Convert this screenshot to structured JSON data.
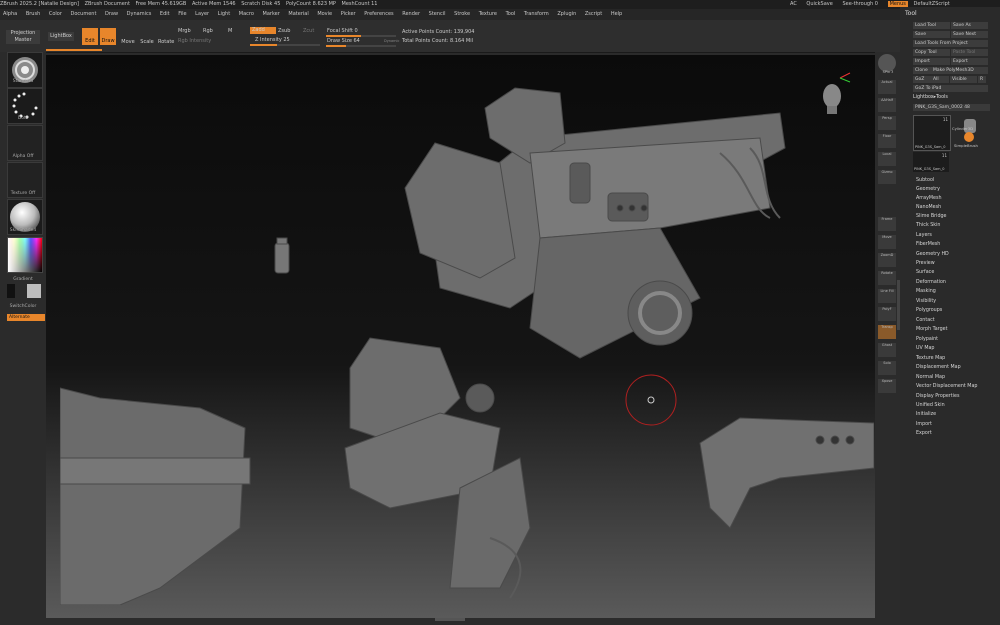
{
  "titlebar": {
    "items": [
      "ZBrush 2025.2 [Natalie Design]",
      "ZBrush Document",
      "Free Mem 45.619GB",
      "Active Mem 1546",
      "Scratch Disk 45",
      "PolyCount 8.623 MP",
      "MeshCount 11"
    ],
    "right": [
      "AC",
      "QuickSave",
      "See-through  0",
      "Menus",
      "DefaultZScript"
    ]
  },
  "menubar": [
    "Alpha",
    "Brush",
    "Color",
    "Document",
    "Draw",
    "Dynamics",
    "Edit",
    "File",
    "Layer",
    "Light",
    "Macro",
    "Marker",
    "Material",
    "Movie",
    "Picker",
    "Preferences",
    "Render",
    "Stencil",
    "Stroke",
    "Texture",
    "Tool",
    "Transform",
    "Zplugin",
    "Zscript",
    "Help"
  ],
  "toolbar": {
    "projection_master": "Projection Master",
    "lightbox": "LightBox",
    "edit": "Edit",
    "draw": "Draw",
    "move": "Move",
    "scale": "Scale",
    "rotate": "Rotate",
    "mrgb": "Mrgb",
    "rgb": "Rgb",
    "m": "M",
    "rgb_intensity": "Rgb Intensity",
    "zadd": "Zadd",
    "zsub": "Zsub",
    "zcut": "Zcut",
    "z_intensity": "Z Intensity 25",
    "focal_shift": "Focal Shift 0",
    "draw_size": "Draw Size 64",
    "dynamic": "Dynamic",
    "active_points": "Active Points Count: 139,904",
    "total_points": "Total Points Count: 8.164 Mil"
  },
  "leftshelf": {
    "standard": "Standard",
    "dots": "Dots",
    "alpha_off": "Alpha Off",
    "texture_off": "Texture Off",
    "material": "SkinShade4",
    "gradient": "Gradient",
    "switch_color": "SwitchColor",
    "alternate": "Alternate"
  },
  "rightshelf": [
    "SPix 3",
    "Actual",
    "AAHalf",
    "Persp",
    "Floor",
    "Local",
    "Gizmo",
    "Frame",
    "Move",
    "ZoomD",
    "Rotate",
    "Line Fill",
    "PolyF",
    "Transp",
    "Ghost",
    "Solo",
    "Xpose"
  ],
  "panel": {
    "title": "Tool",
    "buttons": [
      [
        "Load Tool",
        "Save As"
      ],
      [
        "Save",
        "Save Next"
      ],
      [
        "Load Tools From Project",
        ""
      ],
      [
        "Copy Tool",
        "Paste Tool"
      ],
      [
        "Import",
        "Export"
      ],
      [
        "Clone",
        "Make PolyMesh3D"
      ],
      [
        "GoZ",
        "All",
        "Visible",
        "R"
      ],
      [
        "GoZ To iPad",
        ""
      ]
    ],
    "lightbox_tools": "Lightbox▸Tools",
    "current_tool": "PINK_G3S_Sam_0002 48",
    "thumbs": [
      "PINK_G3S_Sam_0",
      "Cylinder3D",
      "SimpleBrush",
      "PINK_G3S_Sam_0"
    ],
    "thumb_count": "11",
    "subtools": [
      "Subtool",
      "Geometry",
      "ArrayMesh",
      "NanoMesh",
      "Slime Bridge",
      "Thick Skin",
      "Layers",
      "FiberMesh",
      "Geometry HD",
      "Preview",
      "Surface",
      "Deformation",
      "Masking",
      "Visibility",
      "Polygroups",
      "Contact",
      "Morph Target",
      "Polypaint",
      "UV Map",
      "Texture Map",
      "Displacement Map",
      "Normal Map",
      "Vector Displacement Map",
      "Display Properties",
      "Unified Skin",
      "Initialize",
      "Import",
      "Export"
    ]
  },
  "colors": {
    "accent": "#e8862b",
    "panel": "#2a2a2a",
    "bg": "#2b2b2b"
  }
}
